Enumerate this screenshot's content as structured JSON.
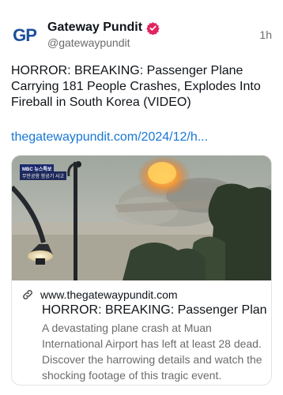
{
  "author": {
    "display_name": "Gateway Pundit",
    "handle": "@gatewaypundit",
    "avatar_text": "GP",
    "verified_color": "#e0245e",
    "verified_icon": "verified-badge-icon"
  },
  "post": {
    "time": "1h",
    "text": "HORROR: BREAKING: Passenger Plane Carrying 181 People Crashes, Explodes Into Fireball in South Korea (VIDEO)",
    "link": "thegatewaypundit.com/2024/12/h..."
  },
  "card": {
    "image_badge": "MBC 뉴스특보",
    "image_caption": "무안공항 항공기 사고",
    "domain": "www.thegatewaypundit.com",
    "title": "HORROR: BREAKING: Passenger Plan...",
    "description": "A devastating plane crash at Muan International Airport has left at least 28 dead. Discover the harrowing details and watch the shocking footage of this tragic event.",
    "link_icon": "link-icon"
  },
  "colors": {
    "link": "#1877d4",
    "avatar_brand": "#1d4f9c",
    "secondary_text": "#6b6b6b"
  }
}
